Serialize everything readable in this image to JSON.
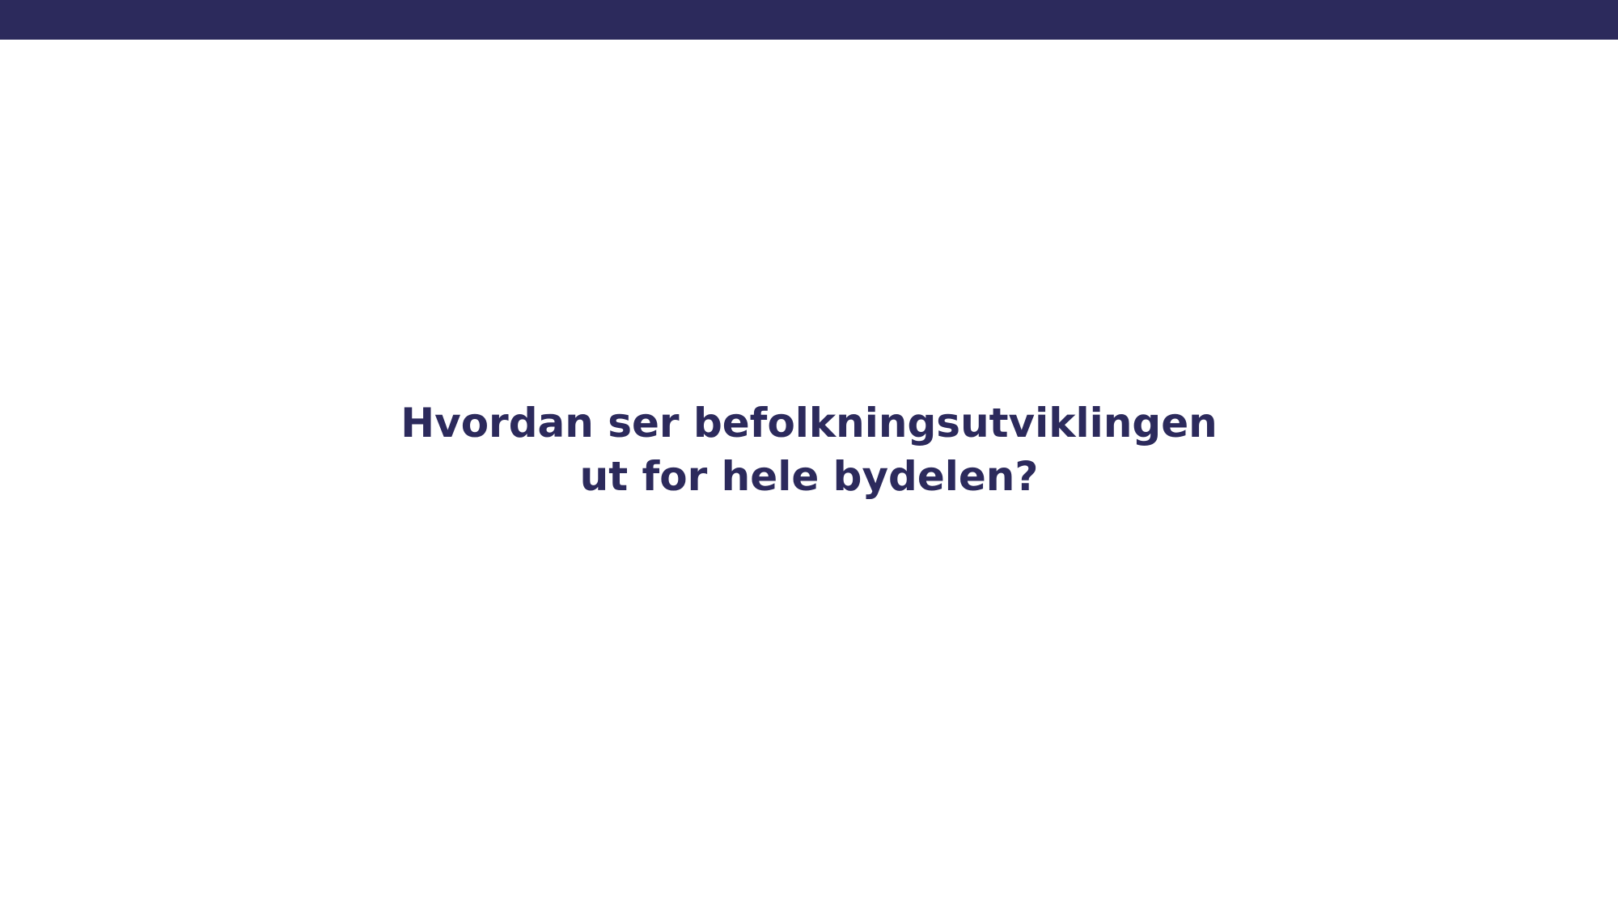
{
  "colors": {
    "brand": "#2c2a5c",
    "background": "#ffffff"
  },
  "slide": {
    "title_line_1": "Hvordan ser befolkningsutviklingen",
    "title_line_2": "ut for hele bydelen?"
  }
}
